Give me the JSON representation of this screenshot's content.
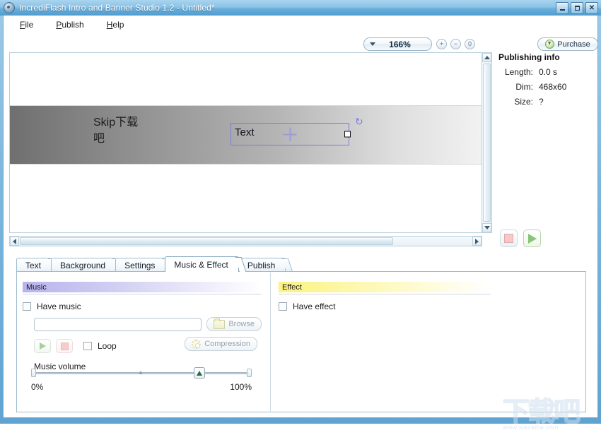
{
  "window": {
    "title": "IncrediFlash Intro and Banner Studio 1.2 - Untitled*",
    "app_icon": "gear-circle-icon",
    "controls": {
      "minimize": "_",
      "maximize": "□",
      "close": "X"
    }
  },
  "menu": {
    "items": [
      "File",
      "Publish",
      "Help"
    ]
  },
  "toolbar": {
    "zoom_value": "166%",
    "zoom_in": "+",
    "zoom_out": "−",
    "zoom_reset": "0",
    "purchase_label": "Purchase"
  },
  "canvas": {
    "banner_text": "Skip下载\n吧",
    "text_object_label": "Text",
    "rotate_handle": "↺"
  },
  "publishing_info": {
    "title": "Publishing info",
    "rows": [
      {
        "label": "Length:",
        "value": "0.0 s"
      },
      {
        "label": "Dim:",
        "value": "468x60"
      },
      {
        "label": "Size:",
        "value": "?"
      }
    ]
  },
  "transport": {
    "stop": "stop-button",
    "play": "play-button"
  },
  "tabs": [
    {
      "label": "Text",
      "active": false
    },
    {
      "label": "Background",
      "active": false
    },
    {
      "label": "Settings",
      "active": false
    },
    {
      "label": "Music & Effect",
      "active": true
    },
    {
      "label": "Publish",
      "active": false
    }
  ],
  "music_panel": {
    "group_title": "Music",
    "have_music_label": "Have music",
    "have_music_checked": false,
    "file_value": "",
    "file_placeholder": "",
    "browse_label": "Browse",
    "loop_label": "Loop",
    "loop_checked": false,
    "compression_label": "Compression",
    "volume_label": "Music volume",
    "volume_min": "0%",
    "volume_max": "100%",
    "volume_value": 75
  },
  "effect_panel": {
    "group_title": "Effect",
    "have_effect_label": "Have effect",
    "have_effect_checked": false
  },
  "watermark": {
    "text": "下载吧",
    "sub": "www.xiazaiba.com"
  },
  "colors": {
    "titlebar_blue": "#6cb0dc",
    "accent_border": "#9dbcd0",
    "music_header": "#b9b3ec",
    "effect_header": "#fcf37f",
    "selection_purple": "#7b7be0",
    "play_green": "#8cc37a",
    "stop_pink": "#f6c9c9"
  }
}
